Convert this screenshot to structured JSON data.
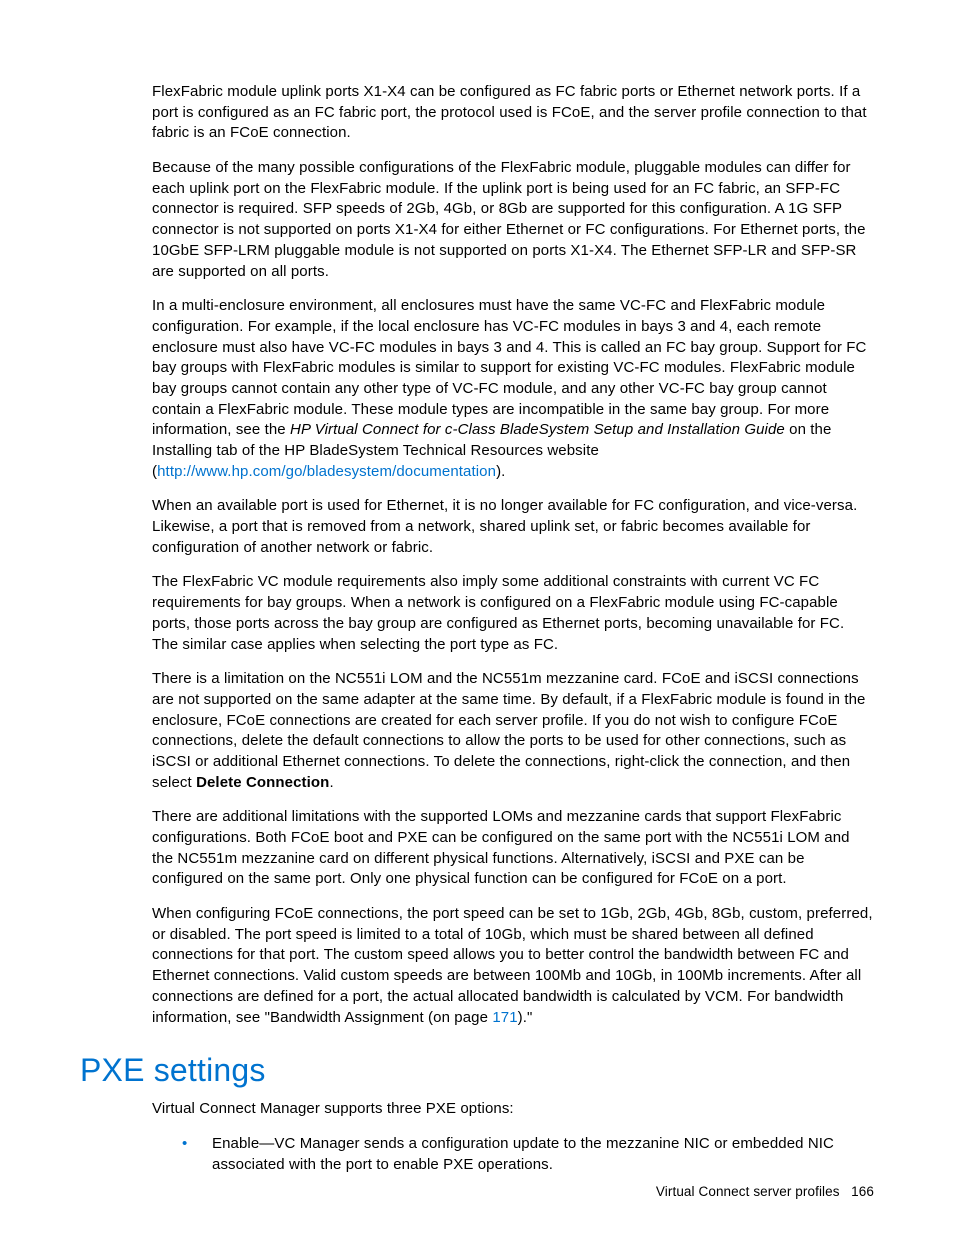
{
  "paragraphs": {
    "p1": "FlexFabric module uplink ports X1-X4 can be configured as FC fabric ports or Ethernet network ports. If a port is configured as an FC fabric port, the protocol used is FCoE, and the server profile connection to that fabric is an FCoE connection.",
    "p2": "Because of the many possible configurations of the FlexFabric module, pluggable modules can differ for each uplink port on the FlexFabric module. If the uplink port is being used for an FC fabric, an SFP-FC connector is required. SFP speeds of 2Gb, 4Gb, or 8Gb are supported for this configuration. A 1G SFP connector is not supported on ports X1-X4 for either Ethernet or FC configurations. For Ethernet ports, the 10GbE SFP-LRM pluggable module is not supported on ports X1-X4. The Ethernet SFP-LR and SFP-SR are supported on all ports.",
    "p3a": "In a multi-enclosure environment, all enclosures must have the same VC-FC and FlexFabric module configuration. For example, if the local enclosure has VC-FC modules in bays 3 and 4, each remote enclosure must also have VC-FC modules in bays 3 and 4. This is called an FC bay group. Support for FC bay groups with FlexFabric modules is similar to support for existing VC-FC modules. FlexFabric module bay groups cannot contain any other type of VC-FC module, and any other VC-FC bay group cannot contain a FlexFabric module. These module types are incompatible in the same bay group. For more information, see the ",
    "p3_italic": "HP Virtual Connect for c-Class BladeSystem Setup and Installation Guide",
    "p3b": " on the Installing tab of the HP BladeSystem Technical Resources website (",
    "p3_link": "http://www.hp.com/go/bladesystem/documentation",
    "p3c": ").",
    "p4": "When an available port is used for Ethernet, it is no longer available for FC configuration, and vice-versa. Likewise, a port that is removed from a network, shared uplink set, or fabric becomes available for configuration of another network or fabric.",
    "p5": "The FlexFabric VC module requirements also imply some additional constraints with current VC FC requirements for bay groups. When a network is configured on a FlexFabric module using FC-capable ports, those ports across the bay group are configured as Ethernet ports, becoming unavailable for FC. The similar case applies when selecting the port type as FC.",
    "p6a": "There is a limitation on the NC551i LOM and the NC551m mezzanine card. FCoE and iSCSI connections are not supported on the same adapter at the same time. By default, if a FlexFabric module is found in the enclosure, FCoE connections are created for each server profile. If you do not wish to configure FCoE connections, delete the default connections to allow the ports to be used for other connections, such as iSCSI or additional Ethernet connections. To delete the connections, right-click the connection, and then select ",
    "p6_bold": "Delete Connection",
    "p6b": ".",
    "p7": "There are additional limitations with the supported LOMs and mezzanine cards that support FlexFabric configurations. Both FCoE boot and PXE can be configured on the same port with the NC551i LOM and the NC551m mezzanine card on different physical functions. Alternatively, iSCSI and PXE can be configured on the same port. Only one physical function can be configured for FCoE on a port.",
    "p8a": "When configuring FCoE connections, the port speed can be set to 1Gb, 2Gb, 4Gb, 8Gb, custom, preferred, or disabled. The port speed is limited to a total of 10Gb, which must be shared between all defined connections for that port. The custom speed allows you to better control the bandwidth between FC and Ethernet connections. Valid custom speeds are between 100Mb and 10Gb, in 100Mb increments. After all connections are defined for a port, the actual allocated bandwidth is calculated by VCM. For bandwidth information, see \"Bandwidth Assignment (on page ",
    "p8_link": "171",
    "p8b": ").\""
  },
  "section_heading": "PXE settings",
  "pxe_intro": "Virtual Connect Manager supports three PXE options:",
  "bullets": {
    "b1": "Enable—VC Manager sends a configuration update to the mezzanine NIC or embedded NIC associated with the port to enable PXE operations."
  },
  "footer": {
    "section": "Virtual Connect server profiles",
    "page": "166"
  }
}
